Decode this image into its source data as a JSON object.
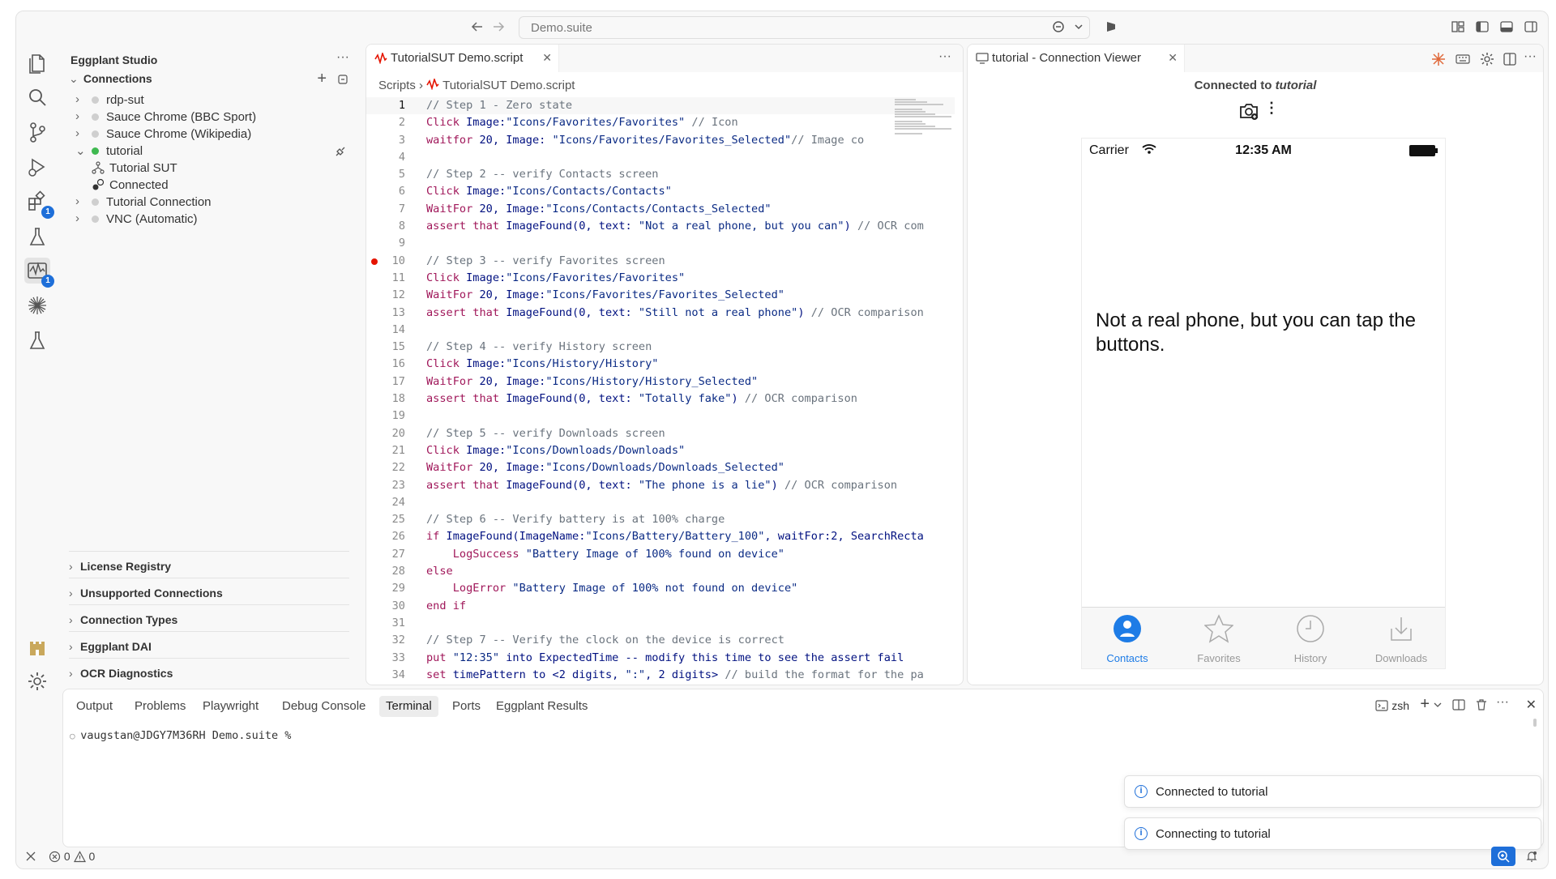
{
  "window": {
    "command_center": "Demo.suite"
  },
  "sidebar": {
    "title": "Eggplant Studio",
    "connections": {
      "label": "Connections",
      "items": [
        {
          "label": "rdp-sut"
        },
        {
          "label": "Sauce Chrome (BBC Sport)"
        },
        {
          "label": "Sauce Chrome (Wikipedia)"
        },
        {
          "label": "tutorial",
          "children": [
            {
              "label": "Tutorial SUT"
            },
            {
              "label": "Connected"
            }
          ]
        },
        {
          "label": "Tutorial Connection"
        },
        {
          "label": "VNC (Automatic)"
        }
      ]
    },
    "sections": [
      {
        "label": "License Registry"
      },
      {
        "label": "Unsupported Connections"
      },
      {
        "label": "Connection Types"
      },
      {
        "label": "Eggplant DAI"
      },
      {
        "label": "OCR Diagnostics"
      }
    ]
  },
  "activity_badges": {
    "extensions": "1",
    "eggplant": "1"
  },
  "editor": {
    "tab_label": "TutorialSUT Demo.script",
    "breadcrumb": {
      "root": "Scripts",
      "file": "TutorialSUT Demo.script"
    },
    "breakpoint_line": 10,
    "current_line": 1,
    "lines": [
      "// Step 1 - Zero state",
      "Click Image:\"Icons/Favorites/Favorites\" // Icon",
      "waitfor 20, Image: \"Icons/Favorites/Favorites_Selected\"// Image co",
      "",
      "// Step 2 -- verify Contacts screen",
      "Click Image:\"Icons/Contacts/Contacts\"",
      "WaitFor 20, Image:\"Icons/Contacts/Contacts_Selected\"",
      "assert that ImageFound(0, text: \"Not a real phone, but you can\") // OCR com",
      "",
      "// Step 3 -- verify Favorites screen",
      "Click Image:\"Icons/Favorites/Favorites\"",
      "WaitFor 20, Image:\"Icons/Favorites/Favorites_Selected\"",
      "assert that ImageFound(0, text: \"Still not a real phone\") // OCR comparison",
      "",
      "// Step 4 -- verify History screen",
      "Click Image:\"Icons/History/History\"",
      "WaitFor 20, Image:\"Icons/History/History_Selected\"",
      "assert that ImageFound(0, text: \"Totally fake\") // OCR comparison",
      "",
      "// Step 5 -- verify Downloads screen",
      "Click Image:\"Icons/Downloads/Downloads\"",
      "WaitFor 20, Image:\"Icons/Downloads/Downloads_Selected\"",
      "assert that ImageFound(0, text: \"The phone is a lie\") // OCR comparison",
      "",
      "// Step 6 -- Verify battery is at 100% charge",
      "if ImageFound(ImageName:\"Icons/Battery/Battery_100\", waitFor:2, SearchRecta",
      "    LogSuccess \"Battery Image of 100% found on device\"",
      "else",
      "    LogError \"Battery Image of 100% not found on device\"",
      "end if",
      "",
      "// Step 7 -- Verify the clock on the device is correct",
      "put \"12:35\" into ExpectedTime -- modify this time to see the assert fail",
      "set timePattern to <2 digits, \":\", 2 digits> // build the format for the pa"
    ]
  },
  "viewer": {
    "tab_label": "tutorial - Connection Viewer",
    "connected_prefix": "Connected to ",
    "connected_name": "tutorial",
    "phone": {
      "carrier": "Carrier",
      "time": "12:35 AM",
      "message": "Not a real phone, but you can tap the buttons.",
      "tabs": [
        "Contacts",
        "Favorites",
        "History",
        "Downloads"
      ],
      "active_tab": "Contacts"
    }
  },
  "panel": {
    "tabs": [
      "Output",
      "Problems",
      "Playwright",
      "Debug Console",
      "Terminal",
      "Ports",
      "Eggplant Results"
    ],
    "active_tab": "Terminal",
    "shell": "zsh",
    "prompt": "vaugstan@JDGY7M36RH Demo.suite %"
  },
  "notifications": [
    "Connected to tutorial",
    "Connecting to tutorial"
  ],
  "statusbar": {
    "errors": "0",
    "warnings": "0"
  },
  "colors": {
    "accent": "#1e6fd9",
    "breakpoint": "#e51400",
    "connected": "#3fb950",
    "comment": "#6a737d",
    "keyword": "#a0175a",
    "string": "#0a2a84"
  }
}
